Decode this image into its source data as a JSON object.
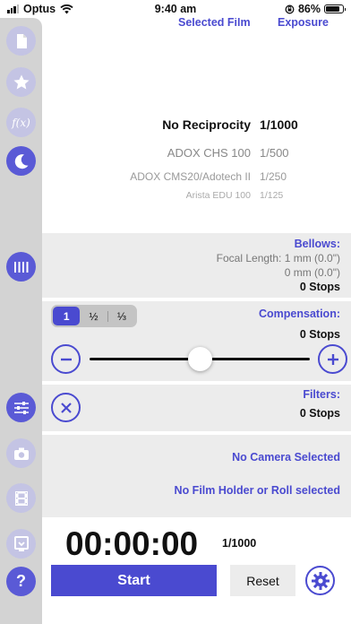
{
  "status_bar": {
    "carrier": "Optus",
    "time": "9:40 am",
    "battery": "86%",
    "battery_level": 0.86
  },
  "colors": {
    "accent": "#4a4ad0",
    "sidebar": "#d3d3d3",
    "panel": "#ececec"
  },
  "sidebar": {
    "icons": [
      "document-icon",
      "star-icon",
      "function-icon",
      "moon-icon",
      "bellows-icon",
      "sliders-icon",
      "camera-icon",
      "film-icon",
      "film-holder-icon",
      "help-icon"
    ],
    "help_label": "?",
    "function_label": "f(x)"
  },
  "picker": {
    "film_header": "Selected Film",
    "exposure_header": "Exposure",
    "rows": [
      {
        "film": "No Reciprocity",
        "exposure": "1/1000"
      },
      {
        "film": "ADOX CHS 100",
        "exposure": "1/500"
      },
      {
        "film": "ADOX CMS20/Adotech II",
        "exposure": "1/250"
      },
      {
        "film": "Arista EDU 100",
        "exposure": "1/125"
      }
    ]
  },
  "bellows": {
    "title": "Bellows:",
    "focal_length": "Focal Length: 1 mm (0.0\")",
    "extension": "0 mm (0.0\")",
    "stops": "0 Stops"
  },
  "compensation": {
    "title": "Compensation:",
    "stops": "0 Stops",
    "segments": [
      "1",
      "½",
      "⅓"
    ],
    "selected_segment": 0,
    "slider_value": 0.5
  },
  "filters": {
    "title": "Filters:",
    "stops": "0 Stops"
  },
  "camera": {
    "label": "No Camera Selected"
  },
  "film_holder": {
    "label": "No Film Holder or Roll selected"
  },
  "timer": {
    "display": "00:00:00",
    "exposure": "1/1000",
    "start_label": "Start",
    "reset_label": "Reset"
  }
}
